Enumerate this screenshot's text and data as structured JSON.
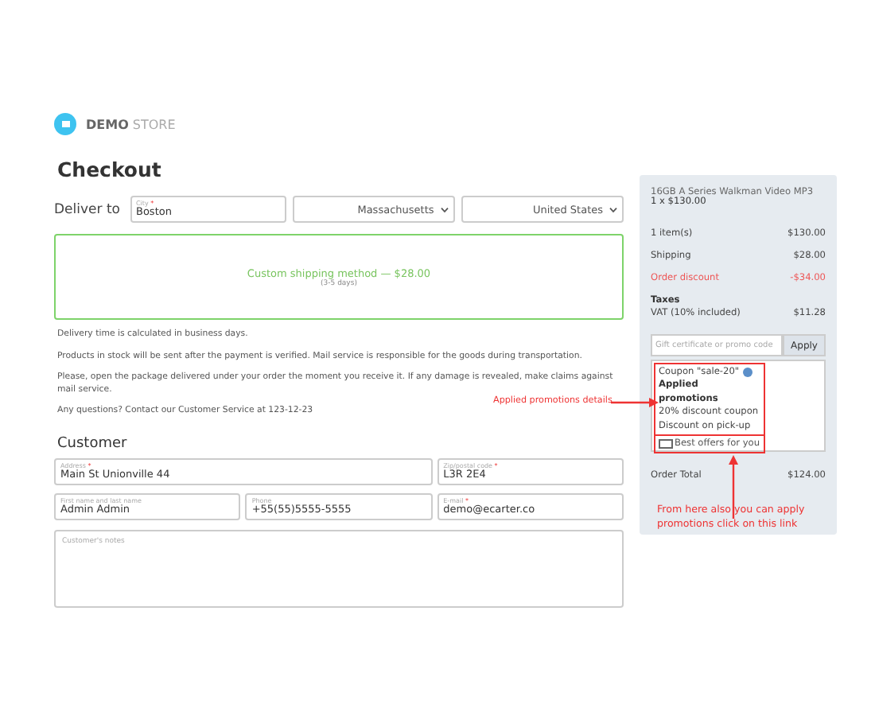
{
  "logo": {
    "bold": "DEMO",
    "rest": "STORE"
  },
  "title": "Checkout",
  "deliver": {
    "label": "Deliver to",
    "city_label": "City",
    "city_mark": "*",
    "city": "Boston",
    "state": "Massachusetts",
    "country": "United States"
  },
  "shipping": {
    "method": "Custom shipping method — $28.00",
    "days": "(3-5 days)",
    "selected": true
  },
  "notes": [
    "Delivery time is calculated in business days.",
    "Products in stock will be sent after the payment is verified. Mail service is responsible for the goods during transportation.",
    "Please, open the package delivered under your order the moment you receive it. If any damage is revealed, make claims against mail service.",
    "Any questions? Contact our Customer Service at 123-12-23"
  ],
  "customer": {
    "heading": "Customer",
    "fields": [
      {
        "label": "Address",
        "mark": "*",
        "value": "Main St Unionville 44"
      },
      {
        "label": "Zip/postal code",
        "mark": "*",
        "value": "L3R 2E4"
      },
      {
        "label": "First name and last name",
        "value": "Admin Admin"
      },
      {
        "label": "Phone",
        "value": "+55(55)5555-5555"
      },
      {
        "label": "E-mail",
        "mark": "*",
        "value": "demo@ecarter.co"
      }
    ],
    "notes_placeholder": "Customer's notes"
  },
  "summary": {
    "product": "16GB A Series Walkman Video MP3",
    "qty": "1 x $130.00",
    "lines": [
      {
        "label": "1 item(s)",
        "value": "$130.00",
        "kind": "normal"
      },
      {
        "label": "Shipping",
        "value": "$28.00",
        "kind": "normal"
      },
      {
        "label": "Order discount",
        "value": "-$34.00",
        "kind": "discount"
      }
    ],
    "taxes": "Taxes",
    "vat_label": "VAT (10% included)",
    "vat": "$11.28",
    "promo_placeholder": "Gift certificate or promo code",
    "apply": "Apply",
    "coupon": "Coupon \"sale-20\"",
    "applied_heading": "Applied promotions",
    "applied": [
      "20% discount coupon",
      "Discount on pick-up"
    ],
    "offers_link": "Best offers for you",
    "total_label": "Order Total",
    "total": "$124.00"
  },
  "annotations": {
    "details": "Applied promotions details",
    "link": "From here also you can apply promotions click on this link"
  }
}
